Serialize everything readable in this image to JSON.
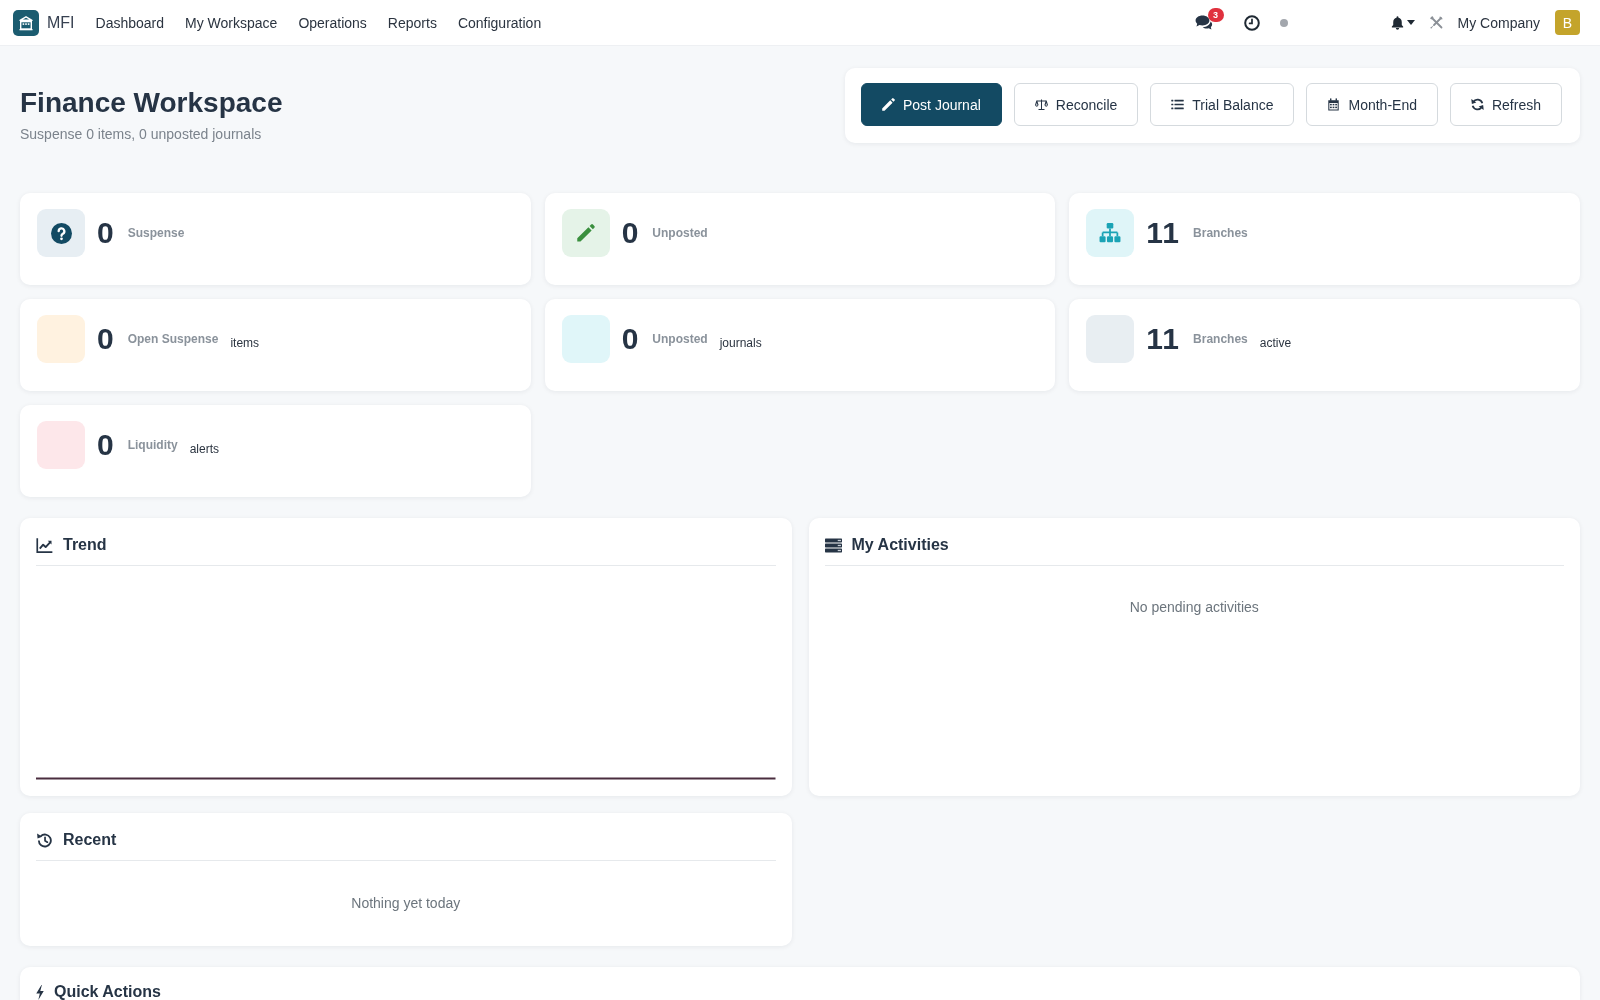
{
  "navbar": {
    "brand": "MFI",
    "menu": [
      "Dashboard",
      "My Workspace",
      "Operations",
      "Reports",
      "Configuration"
    ],
    "messages_count": "3",
    "company": "My Company",
    "avatar_initial": "B"
  },
  "header": {
    "title": "Finance Workspace",
    "subtitle": "Suspense 0 items, 0 unposted journals",
    "actions": [
      {
        "label": "Post Journal",
        "kind": "primary"
      },
      {
        "label": "Reconcile",
        "kind": "outline"
      },
      {
        "label": "Trial Balance",
        "kind": "outline"
      },
      {
        "label": "Month-End",
        "kind": "outline"
      },
      {
        "label": "Refresh",
        "kind": "outline"
      }
    ]
  },
  "stat_cards": [
    {
      "value": "0",
      "label": "Suspense",
      "color": "#e7eef3"
    },
    {
      "value": "0",
      "label": "Unposted",
      "color": "#e5f3e8"
    },
    {
      "value": "11",
      "label": "Branches",
      "color": "#dff5f8"
    },
    {
      "value": "0",
      "label": "Open Suspense",
      "note": "items",
      "color": "#fff2e0"
    },
    {
      "value": "0",
      "label": "Unposted",
      "note": "journals",
      "color": "#e0f6f9"
    },
    {
      "value": "11",
      "label": "Branches",
      "note": "active",
      "color": "#e8eef2"
    },
    {
      "value": "0",
      "label": "Liquidity",
      "note": "alerts",
      "color": "#fde7ea"
    }
  ],
  "trend_panel": {
    "title": "Trend"
  },
  "activities_panel": {
    "title": "My Activities",
    "empty_message": "No pending activities"
  },
  "recent_panel": {
    "title": "Recent",
    "empty_message": "Nothing yet today"
  },
  "quick_actions_panel": {
    "title": "Quick Actions"
  }
}
